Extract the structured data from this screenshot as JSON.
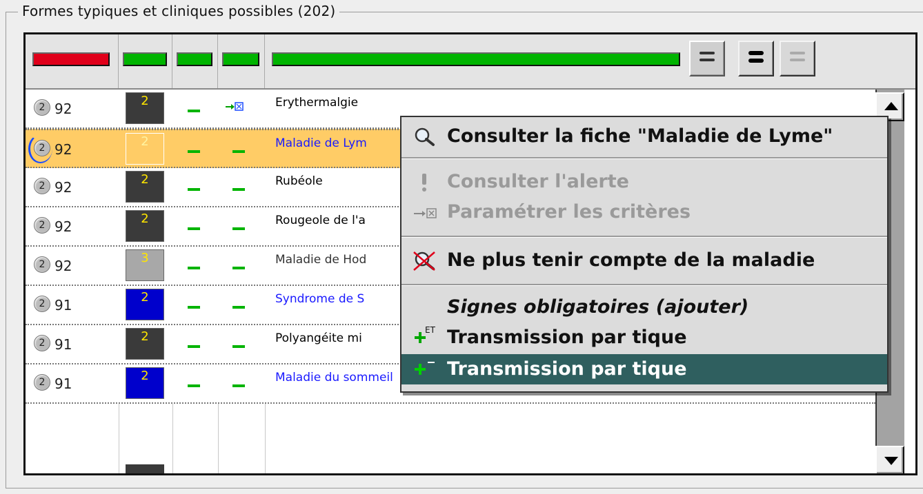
{
  "group": {
    "title": "Formes typiques et cliniques possibles (202)"
  },
  "header": {
    "bar_colors": [
      "#e0001a",
      "#00b400",
      "#00b400",
      "#00b400",
      "#00b400"
    ],
    "view_buttons": [
      {
        "name": "view-normal-button",
        "icon": "two-lines-icon"
      },
      {
        "name": "view-bold-button",
        "icon": "two-bold-lines-icon"
      },
      {
        "name": "view-light-button",
        "icon": "two-light-lines-icon"
      }
    ]
  },
  "rows": [
    {
      "score_badge": "2",
      "score": "92",
      "level": "2",
      "level_color": "#3a3a3a",
      "col3": "dash",
      "col4": "criteria-icon",
      "name": "Erythermalgie",
      "name_color": "#000000"
    },
    {
      "score_badge": "2",
      "score": "92",
      "level": "2",
      "level_color": "#ffcc66",
      "col3": "dash",
      "col4": "dash",
      "name": "Maladie de Lym",
      "name_color": "#1a1aff",
      "selected": true
    },
    {
      "score_badge": "2",
      "score": "92",
      "level": "2",
      "level_color": "#3a3a3a",
      "col3": "dash",
      "col4": "dash",
      "name": "Rubéole",
      "name_color": "#000000"
    },
    {
      "score_badge": "2",
      "score": "92",
      "level": "2",
      "level_color": "#3a3a3a",
      "col3": "dash",
      "col4": "dash",
      "name": "Rougeole de l'a",
      "name_color": "#000000"
    },
    {
      "score_badge": "2",
      "score": "92",
      "level": "3",
      "level_color": "#a8a8a8",
      "col3": "dash",
      "col4": "dash",
      "name": "Maladie de Hod",
      "name_color": "#333333"
    },
    {
      "score_badge": "2",
      "score": "91",
      "level": "2",
      "level_color": "#0000cc",
      "col3": "dash",
      "col4": "dash",
      "name": "Syndrome de S",
      "name_color": "#1a1aff"
    },
    {
      "score_badge": "2",
      "score": "91",
      "level": "2",
      "level_color": "#3a3a3a",
      "col3": "dash",
      "col4": "dash",
      "name": "Polyangéite mi",
      "name_color": "#000000"
    },
    {
      "score_badge": "2",
      "score": "91",
      "level": "2",
      "level_color": "#0000cc",
      "col3": "dash",
      "col4": "dash",
      "name": "Maladie du sommeil",
      "name_color": "#1a1aff"
    }
  ],
  "context_menu": {
    "items": [
      {
        "label": "Consulter la fiche \"Maladie de Lyme\"",
        "icon": "magnifier-icon",
        "enabled": true
      },
      {
        "label": "Consulter l'alerte",
        "icon": "exclamation-icon",
        "enabled": false
      },
      {
        "label": "Paramétrer les critères",
        "icon": "criteria-icon",
        "enabled": false
      },
      {
        "label": "Ne plus tenir compte de la maladie",
        "icon": "crossed-magnifier-icon",
        "enabled": true
      },
      {
        "label": "Signes obligatoires (ajouter)",
        "icon": "",
        "enabled": true,
        "italic": true
      },
      {
        "label": "Transmission par tique",
        "icon": "plus-et-icon",
        "enabled": true
      },
      {
        "label": "Transmission par tique",
        "icon": "plus-minus-icon",
        "enabled": true,
        "highlighted": true
      }
    ],
    "plus_et_superscript": "ET"
  }
}
